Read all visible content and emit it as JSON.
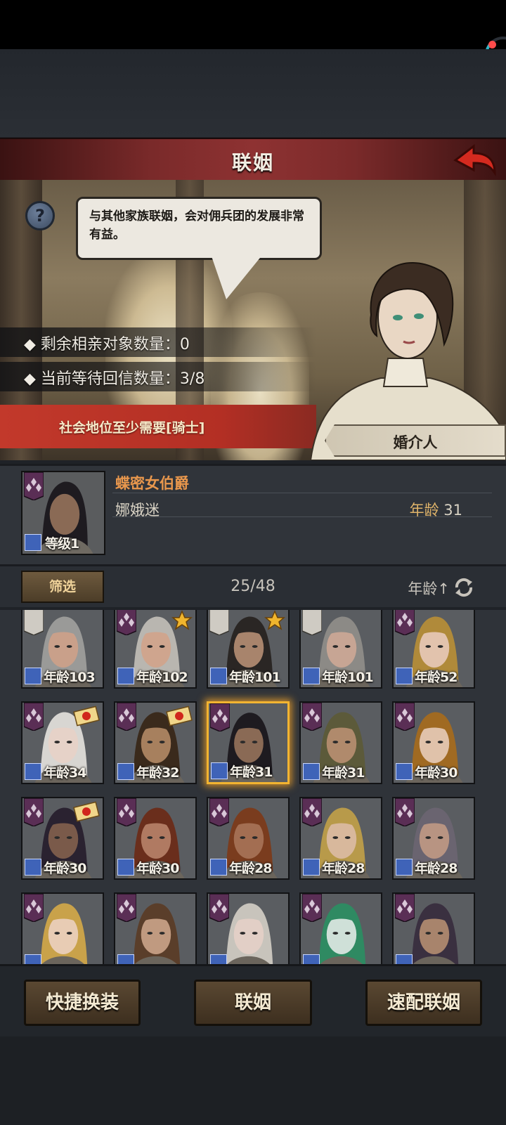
{
  "title": "联姻",
  "speech": "与其他家族联姻，会对佣兵团的发展非常有益。",
  "stats": {
    "remaining": "◆ 剩余相亲对象数量：0",
    "waiting": "◆ 当前等待回信数量：3/8"
  },
  "requirement": "社会地位至少需要[骑士]",
  "matchmaker_label": "婚介人",
  "hero": {
    "title": "蝶密女伯爵",
    "name": "娜娥迷",
    "age_label": "年龄",
    "age_value": "31",
    "level_label": "等级1"
  },
  "filter": {
    "button": "筛选",
    "count": "25/48",
    "sort": "年龄↑"
  },
  "candidates": [
    {
      "age": "年龄103",
      "emblem": "banner",
      "badge": "none"
    },
    {
      "age": "年龄102",
      "emblem": "diamond",
      "badge": "star"
    },
    {
      "age": "年龄101",
      "emblem": "banner",
      "badge": "star"
    },
    {
      "age": "年龄101",
      "emblem": "banner",
      "badge": "none"
    },
    {
      "age": "年龄52",
      "emblem": "diamond",
      "badge": "none"
    },
    {
      "age": "年龄34",
      "emblem": "diamond",
      "badge": "letter"
    },
    {
      "age": "年龄32",
      "emblem": "diamond",
      "badge": "letter"
    },
    {
      "age": "年龄31",
      "emblem": "diamond",
      "badge": "none",
      "selected": true
    },
    {
      "age": "年龄31",
      "emblem": "diamond",
      "badge": "none"
    },
    {
      "age": "年龄30",
      "emblem": "diamond",
      "badge": "none"
    },
    {
      "age": "年龄30",
      "emblem": "diamond",
      "badge": "letter"
    },
    {
      "age": "年龄30",
      "emblem": "diamond",
      "badge": "none"
    },
    {
      "age": "年龄28",
      "emblem": "diamond",
      "badge": "none"
    },
    {
      "age": "年龄28",
      "emblem": "diamond",
      "badge": "none"
    },
    {
      "age": "年龄28",
      "emblem": "diamond",
      "badge": "none"
    },
    {
      "age": "",
      "emblem": "diamond",
      "badge": "none"
    },
    {
      "age": "",
      "emblem": "diamond",
      "badge": "none"
    },
    {
      "age": "",
      "emblem": "diamond",
      "badge": "none"
    },
    {
      "age": "",
      "emblem": "diamond",
      "badge": "none"
    },
    {
      "age": "",
      "emblem": "diamond",
      "badge": "none"
    }
  ],
  "buttons": {
    "quick_outfit": "快捷换装",
    "marry": "联姻",
    "quick_match": "速配联姻"
  },
  "colors": {
    "title_red": "#8e3232",
    "requirement_red": "#c2392b",
    "highlight_gold": "#f2b431",
    "hero_title_orange": "#e8974d",
    "emblem_purple": "#5a2e55"
  }
}
